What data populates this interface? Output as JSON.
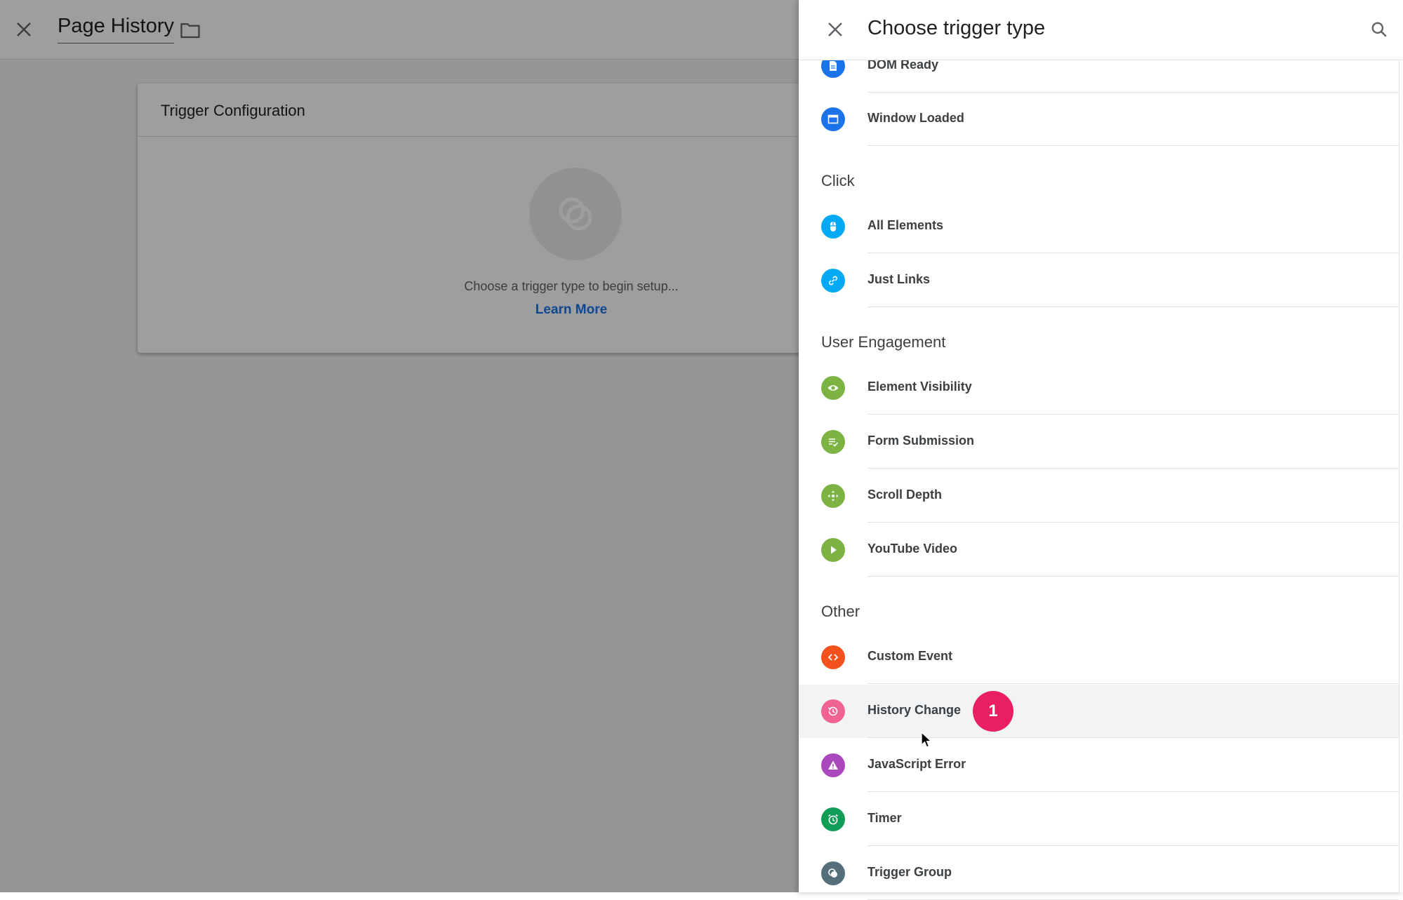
{
  "editor": {
    "title": "Page History",
    "card": {
      "title": "Trigger Configuration",
      "hint": "Choose a trigger type to begin setup...",
      "learn_more": "Learn More"
    }
  },
  "panel": {
    "title": "Choose trigger type",
    "items_top": [
      {
        "label": "DOM Ready",
        "icon": "document-icon",
        "color": "#1a73e8"
      },
      {
        "label": "Window Loaded",
        "icon": "window-icon",
        "color": "#1a73e8"
      }
    ],
    "sections": [
      {
        "title": "Click",
        "items": [
          {
            "label": "All Elements",
            "icon": "mouse-icon",
            "color": "#03a9f4"
          },
          {
            "label": "Just Links",
            "icon": "link-icon",
            "color": "#03a9f4"
          }
        ]
      },
      {
        "title": "User Engagement",
        "items": [
          {
            "label": "Element Visibility",
            "icon": "eye-icon",
            "color": "#7cb342"
          },
          {
            "label": "Form Submission",
            "icon": "form-check-icon",
            "color": "#7cb342"
          },
          {
            "label": "Scroll Depth",
            "icon": "scroll-arrows-icon",
            "color": "#7cb342"
          },
          {
            "label": "YouTube Video",
            "icon": "play-icon",
            "color": "#7cb342"
          }
        ]
      },
      {
        "title": "Other",
        "items": [
          {
            "label": "Custom Event",
            "icon": "code-icon",
            "color": "#f4511e"
          },
          {
            "label": "History Change",
            "icon": "history-icon",
            "color": "#f06292"
          },
          {
            "label": "JavaScript Error",
            "icon": "warning-icon",
            "color": "#ab47bc"
          },
          {
            "label": "Timer",
            "icon": "alarm-icon",
            "color": "#0f9d58"
          },
          {
            "label": "Trigger Group",
            "icon": "trigger-group-icon",
            "color": "#546e7a"
          }
        ]
      }
    ]
  },
  "annotation": {
    "step": "1"
  }
}
